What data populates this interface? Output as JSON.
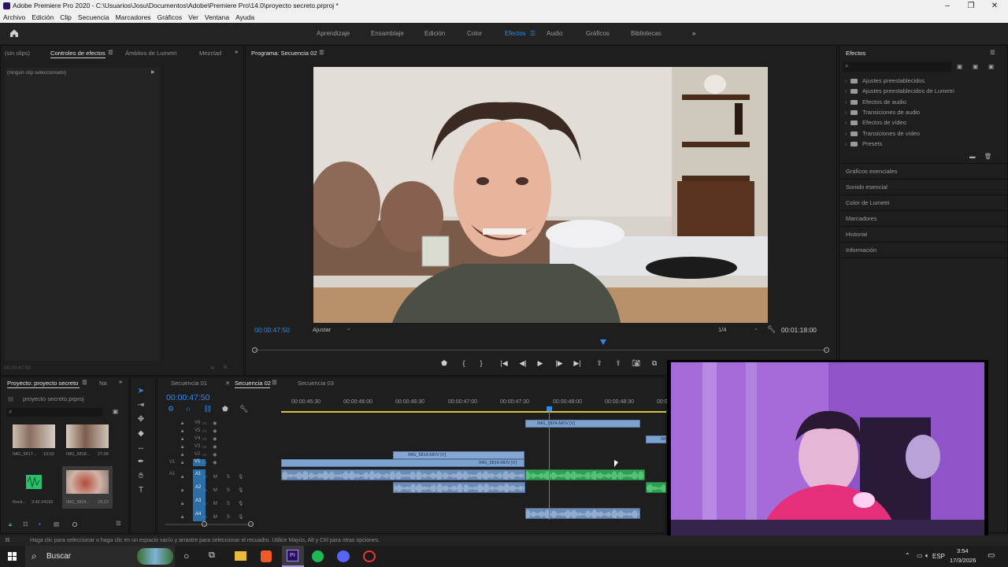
{
  "window": {
    "title": "Adobe Premiere Pro 2020 - C:\\Usuarios\\Josu\\Documentos\\Adobe\\Premiere Pro\\14.0\\proyecto secreto.prproj *",
    "controls": [
      "–",
      "❐",
      "✕"
    ]
  },
  "menu": [
    "Archivo",
    "Edición",
    "Clip",
    "Secuencia",
    "Marcadores",
    "Gráficos",
    "Ver",
    "Ventana",
    "Ayuda"
  ],
  "workspaces": {
    "items": [
      "Aprendizaje",
      "Ensamblaje",
      "Edición",
      "Color",
      "Efectos",
      "Audio",
      "Gráficos",
      "Bibliotecas"
    ],
    "active": "Efectos",
    "more": "»"
  },
  "source_panel": {
    "tabs": [
      "(sin clips)",
      "Controles de efectos",
      "Ámbitos de Lumetri",
      "Mezclad"
    ],
    "active_tab": "Controles de efectos",
    "no_clip": "(ningún clip seleccionado)",
    "timecode": "00:00:47:50"
  },
  "program_monitor": {
    "tab": "Programa: Secuencia 02",
    "timecode": "00:00:47:50",
    "fit": "Ajustar",
    "resolution": "1/4",
    "duration": "00:01:18:00",
    "playhead_fraction": 0.61
  },
  "effects_panel": {
    "title": "Efectos",
    "search_placeholder": "",
    "folders": [
      "Ajustes preestablecidos",
      "Ajustes preestablecidos de Lumetri",
      "Efectos de audio",
      "Transiciones de audio",
      "Efectos de vídeo",
      "Transiciones de vídeo",
      "Presets"
    ],
    "sections": [
      "Gráficos esenciales",
      "Sonido esencial",
      "Color de Lumetri",
      "Marcadores",
      "Historial",
      "Información"
    ]
  },
  "project_panel": {
    "tabs": [
      "Proyecto: proyecto secreto",
      "Na"
    ],
    "file": "proyecto secreto.prproj",
    "items": [
      {
        "name": "IMG_5817...",
        "duration": "19;02"
      },
      {
        "name": "IMG_5818...",
        "duration": "27;08"
      },
      {
        "name": "Rock...",
        "duration": "3:42:24192"
      },
      {
        "name": "IMG_5824...",
        "duration": "29;22"
      }
    ]
  },
  "timeline": {
    "tabs": [
      "Secuencia 01",
      "Secuencia 02",
      "Secuencia 03"
    ],
    "active_tab": "Secuencia 02",
    "timecode": "00:00:47:50",
    "ruler": [
      "00:00:45:30",
      "00:00:46:00",
      "00:00:46:30",
      "00:00:47:00",
      "00:00:47:30",
      "00:00:48:00",
      "00:00:48:30",
      "00:0"
    ],
    "video_tracks": [
      "V6",
      "V5",
      "V4",
      "V3",
      "V2",
      "V1"
    ],
    "audio_tracks": [
      "A1",
      "A2",
      "A3",
      "A4"
    ],
    "source_patch": {
      "video": "V1",
      "audio": "A1"
    },
    "track_buttons": {
      "mute": "M",
      "solo": "S"
    },
    "clips": {
      "v6": "IMG_5824.MOV [V]",
      "v2": "IMG_5814.MOV [V]",
      "v1": "IMG_5814.MOV [V]",
      "v6b": "IM"
    }
  },
  "status_bar": "Haga clic para seleccionar o haga clic en un espacio vacío y arrastre para seleccionar el recuadro. Utilice Mayús, Alt y Ctrl para otras opciones.",
  "taskbar": {
    "search": "Buscar",
    "lang": "ESP",
    "time": "3:54",
    "date": "17/3/2026"
  },
  "colors": {
    "accent": "#2d8ceb",
    "audio_clip": "#2f9f52",
    "video_clip": "#7ea2cf"
  }
}
